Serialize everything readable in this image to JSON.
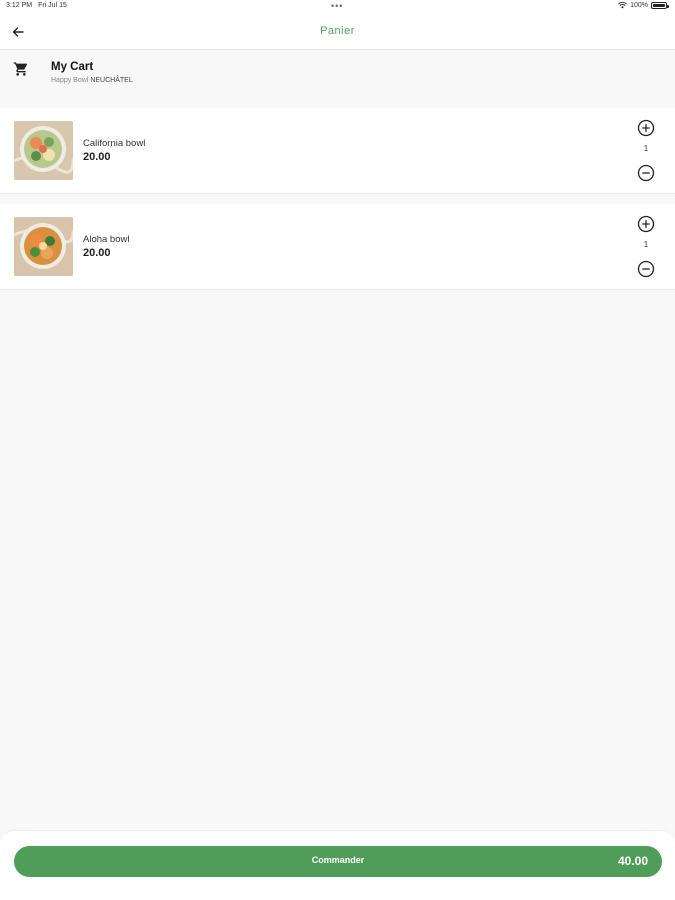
{
  "status_bar": {
    "time": "3:12 PM",
    "date": "Fri Jul 15",
    "battery": "100%"
  },
  "nav": {
    "title": "Panier",
    "back_icon": "arrow-left-icon"
  },
  "cart": {
    "title": "My Cart",
    "restaurant": "Happy Bowl",
    "city": "NEUCHÂTEL",
    "icon": "cart-icon"
  },
  "items": [
    {
      "name": "California bowl",
      "price": "20.00",
      "quantity": "1"
    },
    {
      "name": "Aloha bowl",
      "price": "20.00",
      "quantity": "1"
    }
  ],
  "footer": {
    "order_label": "Commander",
    "total": "40.00"
  },
  "colors": {
    "accent": "#4f9d58",
    "title": "#55a05f"
  }
}
